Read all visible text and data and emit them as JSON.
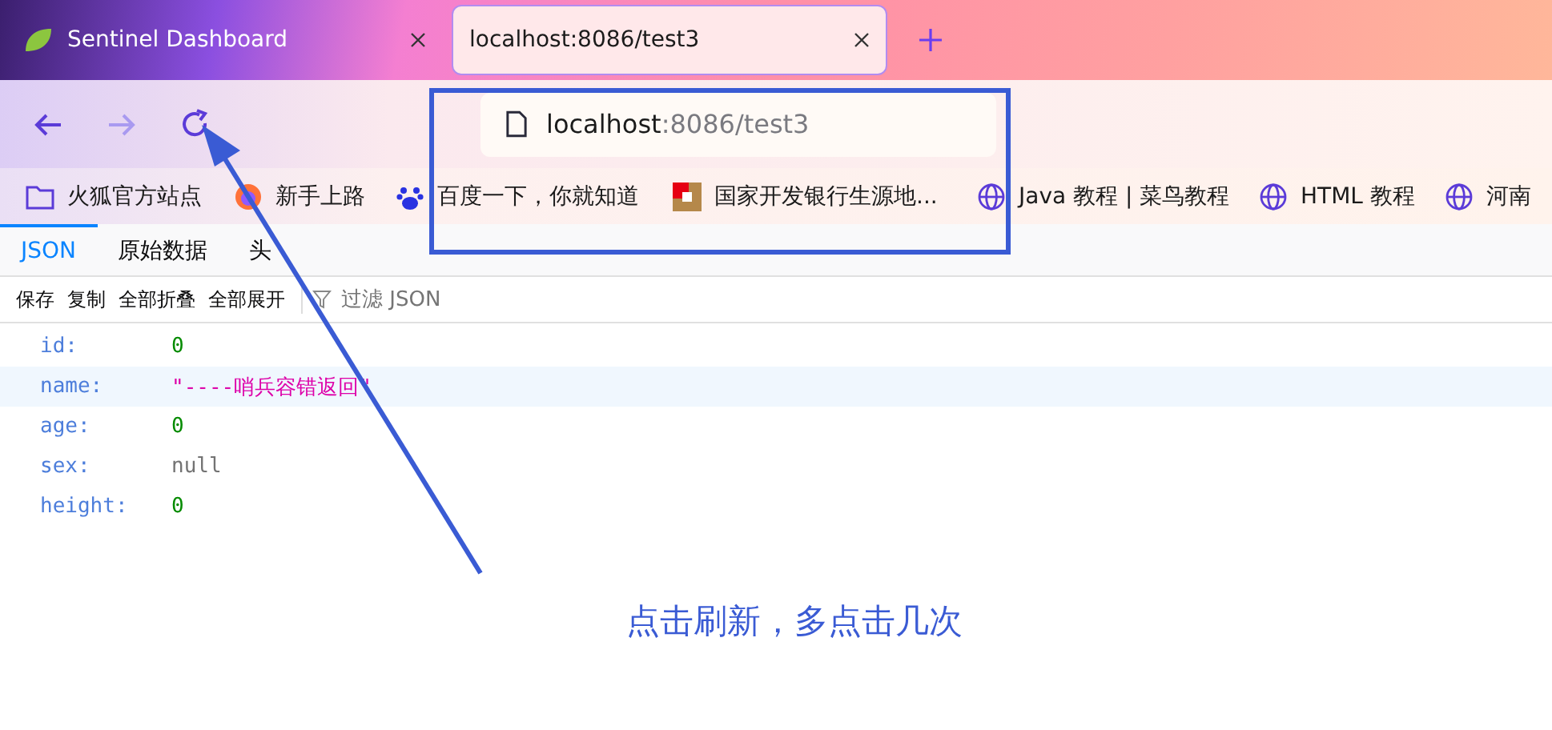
{
  "tabs": [
    {
      "title": "Sentinel Dashboard",
      "selected": false
    },
    {
      "title": "localhost:8086/test3",
      "selected": true
    }
  ],
  "address": {
    "host": "localhost",
    "rest": ":8086/test3"
  },
  "bookmarks": [
    {
      "label": "火狐官方站点",
      "kind": "folder"
    },
    {
      "label": "新手上路",
      "kind": "firefox"
    },
    {
      "label": "百度一下，你就知道",
      "kind": "paw"
    },
    {
      "label": "国家开发银行生源地...",
      "kind": "bank"
    },
    {
      "label": "Java 教程 | 菜鸟教程",
      "kind": "globe"
    },
    {
      "label": "HTML 教程",
      "kind": "globe"
    },
    {
      "label": "河南",
      "kind": "globe"
    }
  ],
  "viewer_tabs": [
    {
      "label": "JSON",
      "selected": true
    },
    {
      "label": "原始数据",
      "selected": false
    },
    {
      "label": "头",
      "selected": false
    }
  ],
  "viewer_toolbar": [
    "保存",
    "复制",
    "全部折叠",
    "全部展开"
  ],
  "filter": {
    "placeholder": "过滤 JSON"
  },
  "rows": [
    {
      "key": "id:",
      "value": "0",
      "kind": "number",
      "selected": false
    },
    {
      "key": "name:",
      "value": "\"----哨兵容错返回\"",
      "kind": "string",
      "selected": true
    },
    {
      "key": "age:",
      "value": "0",
      "kind": "number",
      "selected": false
    },
    {
      "key": "sex:",
      "value": "null",
      "kind": "null",
      "selected": false
    },
    {
      "key": "height:",
      "value": "0",
      "kind": "number",
      "selected": false
    }
  ],
  "annotation": {
    "text": "点击刷新，多点击几次"
  }
}
